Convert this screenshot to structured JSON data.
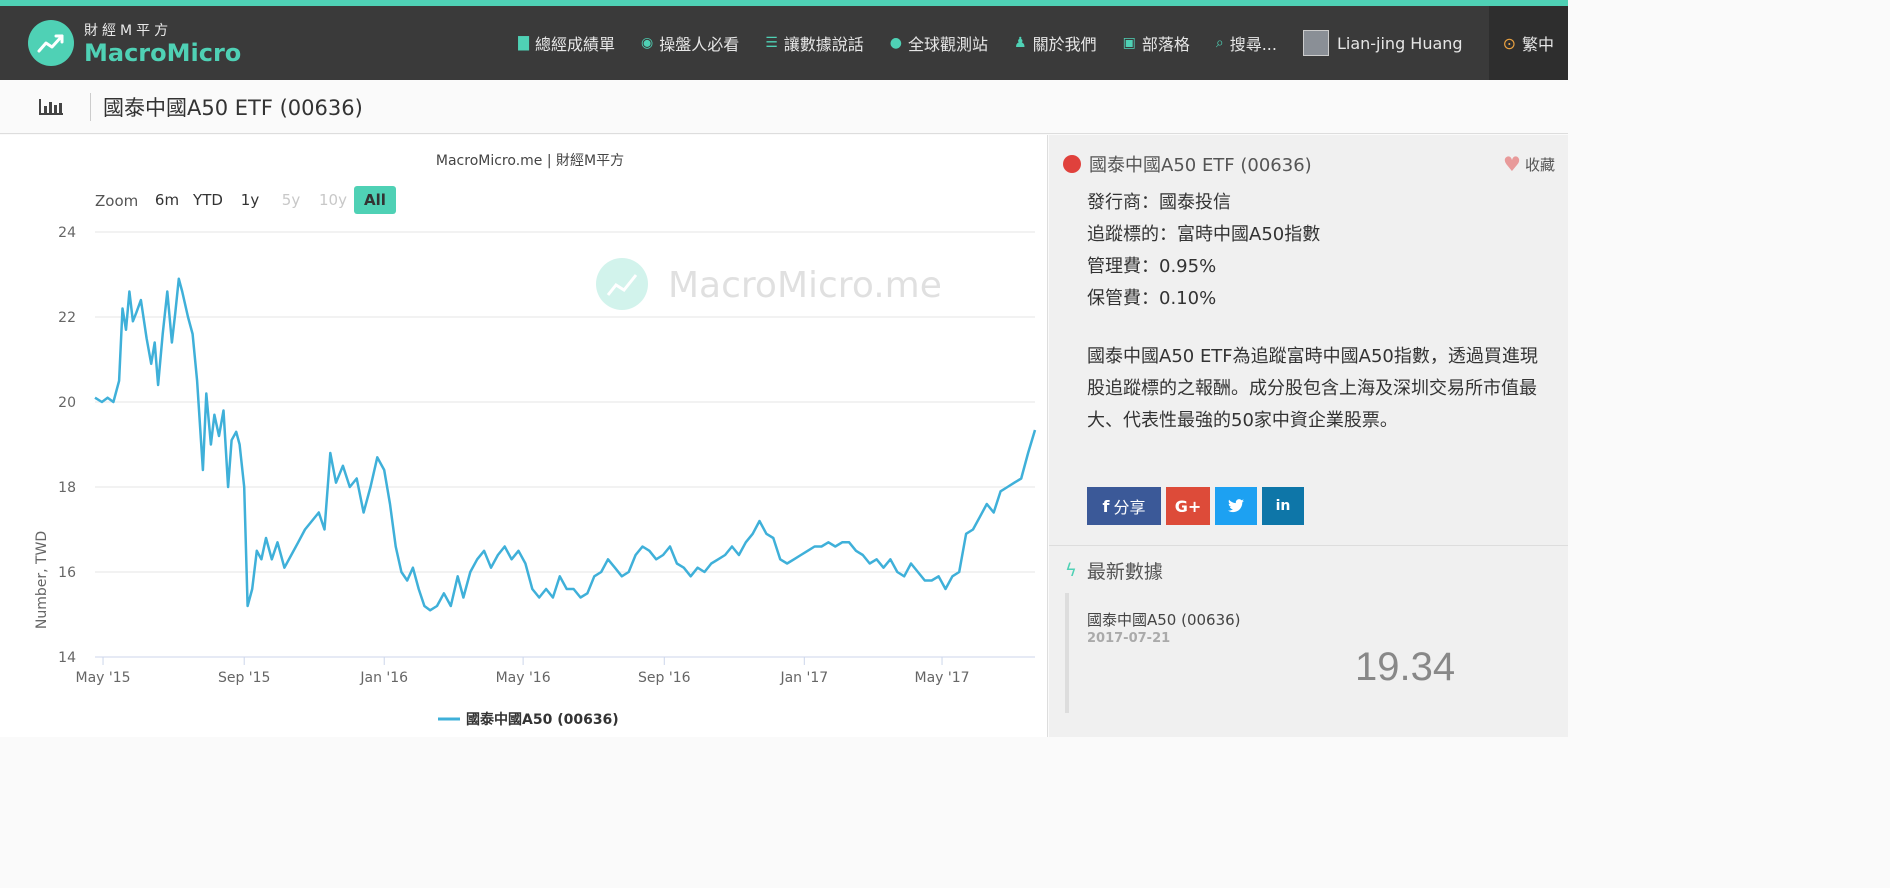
{
  "app": {
    "logo_cn": "財經M平方",
    "logo_en": "MacroMicro",
    "accent": "#4fd1b5"
  },
  "nav": {
    "items": [
      {
        "icon": "document-icon",
        "label": "總經成績單"
      },
      {
        "icon": "eye-icon",
        "label": "操盤人必看"
      },
      {
        "icon": "database-icon",
        "label": "讓數據說話"
      },
      {
        "icon": "globe-icon",
        "label": "全球觀測站"
      },
      {
        "icon": "people-icon",
        "label": "關於我們"
      },
      {
        "icon": "rss-icon",
        "label": "部落格"
      },
      {
        "icon": "search-icon",
        "label": "搜尋..."
      }
    ],
    "user_name": "Lian-jing Huang",
    "lang_label": "繁中"
  },
  "page": {
    "title": "國泰中國A50 ETF (00636)"
  },
  "chart": {
    "credit": "MacroMicro.me | 財經M平方",
    "watermark": "MacroMicro.me",
    "zoom_label": "Zoom",
    "zoom_options": [
      "6m",
      "YTD",
      "1y",
      "5y",
      "10y",
      "All"
    ],
    "zoom_active": "All",
    "zoom_disabled": [
      "5y",
      "10y"
    ]
  },
  "chart_data": {
    "type": "line",
    "ylabel": "Number, TWD",
    "ylim": [
      14,
      24
    ],
    "yticks": [
      14,
      16,
      18,
      20,
      22,
      24
    ],
    "xlim": [
      "2015-04-24",
      "2017-07-21"
    ],
    "xticks": [
      {
        "date": "2015-05-01",
        "label": "May '15"
      },
      {
        "date": "2015-09-01",
        "label": "Sep '15"
      },
      {
        "date": "2016-01-01",
        "label": "Jan '16"
      },
      {
        "date": "2016-05-01",
        "label": "May '16"
      },
      {
        "date": "2016-09-01",
        "label": "Sep '16"
      },
      {
        "date": "2017-01-01",
        "label": "Jan '17"
      },
      {
        "date": "2017-05-01",
        "label": "May '17"
      }
    ],
    "legend": "bottom",
    "series": [
      {
        "name": "國泰中國A50 (00636)",
        "color": "#3fb0d9",
        "points": [
          [
            "2015-04-24",
            20.1
          ],
          [
            "2015-04-30",
            20.0
          ],
          [
            "2015-05-05",
            20.1
          ],
          [
            "2015-05-10",
            20.0
          ],
          [
            "2015-05-15",
            20.5
          ],
          [
            "2015-05-18",
            22.2
          ],
          [
            "2015-05-21",
            21.7
          ],
          [
            "2015-05-24",
            22.6
          ],
          [
            "2015-05-27",
            21.9
          ],
          [
            "2015-05-30",
            22.1
          ],
          [
            "2015-06-03",
            22.4
          ],
          [
            "2015-06-08",
            21.5
          ],
          [
            "2015-06-12",
            20.9
          ],
          [
            "2015-06-15",
            21.4
          ],
          [
            "2015-06-18",
            20.4
          ],
          [
            "2015-06-22",
            21.6
          ],
          [
            "2015-06-26",
            22.6
          ],
          [
            "2015-06-30",
            21.4
          ],
          [
            "2015-07-03",
            22.1
          ],
          [
            "2015-07-06",
            22.9
          ],
          [
            "2015-07-09",
            22.6
          ],
          [
            "2015-07-14",
            22.0
          ],
          [
            "2015-07-18",
            21.6
          ],
          [
            "2015-07-22",
            20.5
          ],
          [
            "2015-07-27",
            18.4
          ],
          [
            "2015-07-30",
            20.2
          ],
          [
            "2015-08-03",
            19.0
          ],
          [
            "2015-08-06",
            19.7
          ],
          [
            "2015-08-10",
            19.2
          ],
          [
            "2015-08-14",
            19.8
          ],
          [
            "2015-08-18",
            18.0
          ],
          [
            "2015-08-21",
            19.1
          ],
          [
            "2015-08-25",
            19.3
          ],
          [
            "2015-08-28",
            19.0
          ],
          [
            "2015-09-01",
            18.0
          ],
          [
            "2015-09-04",
            15.2
          ],
          [
            "2015-09-08",
            15.6
          ],
          [
            "2015-09-12",
            16.5
          ],
          [
            "2015-09-16",
            16.3
          ],
          [
            "2015-09-20",
            16.8
          ],
          [
            "2015-09-25",
            16.3
          ],
          [
            "2015-09-30",
            16.7
          ],
          [
            "2015-10-06",
            16.1
          ],
          [
            "2015-10-12",
            16.4
          ],
          [
            "2015-10-18",
            16.7
          ],
          [
            "2015-10-24",
            17.0
          ],
          [
            "2015-10-30",
            17.2
          ],
          [
            "2015-11-05",
            17.4
          ],
          [
            "2015-11-10",
            17.0
          ],
          [
            "2015-11-15",
            18.8
          ],
          [
            "2015-11-20",
            18.1
          ],
          [
            "2015-11-26",
            18.5
          ],
          [
            "2015-12-02",
            18.0
          ],
          [
            "2015-12-08",
            18.2
          ],
          [
            "2015-12-14",
            17.4
          ],
          [
            "2015-12-20",
            18.0
          ],
          [
            "2015-12-26",
            18.7
          ],
          [
            "2016-01-01",
            18.4
          ],
          [
            "2016-01-06",
            17.6
          ],
          [
            "2016-01-11",
            16.6
          ],
          [
            "2016-01-16",
            16.0
          ],
          [
            "2016-01-21",
            15.8
          ],
          [
            "2016-01-26",
            16.1
          ],
          [
            "2016-01-31",
            15.6
          ],
          [
            "2016-02-05",
            15.2
          ],
          [
            "2016-02-10",
            15.1
          ],
          [
            "2016-02-16",
            15.2
          ],
          [
            "2016-02-22",
            15.5
          ],
          [
            "2016-02-28",
            15.2
          ],
          [
            "2016-03-05",
            15.9
          ],
          [
            "2016-03-10",
            15.4
          ],
          [
            "2016-03-16",
            16.0
          ],
          [
            "2016-03-22",
            16.3
          ],
          [
            "2016-03-28",
            16.5
          ],
          [
            "2016-04-03",
            16.1
          ],
          [
            "2016-04-09",
            16.4
          ],
          [
            "2016-04-15",
            16.6
          ],
          [
            "2016-04-21",
            16.3
          ],
          [
            "2016-04-27",
            16.5
          ],
          [
            "2016-05-03",
            16.2
          ],
          [
            "2016-05-09",
            15.6
          ],
          [
            "2016-05-15",
            15.4
          ],
          [
            "2016-05-21",
            15.6
          ],
          [
            "2016-05-27",
            15.4
          ],
          [
            "2016-06-02",
            15.9
          ],
          [
            "2016-06-08",
            15.6
          ],
          [
            "2016-06-14",
            15.6
          ],
          [
            "2016-06-20",
            15.4
          ],
          [
            "2016-06-26",
            15.5
          ],
          [
            "2016-07-02",
            15.9
          ],
          [
            "2016-07-08",
            16.0
          ],
          [
            "2016-07-14",
            16.3
          ],
          [
            "2016-07-20",
            16.1
          ],
          [
            "2016-07-26",
            15.9
          ],
          [
            "2016-08-01",
            16.0
          ],
          [
            "2016-08-07",
            16.4
          ],
          [
            "2016-08-13",
            16.6
          ],
          [
            "2016-08-19",
            16.5
          ],
          [
            "2016-08-25",
            16.3
          ],
          [
            "2016-08-31",
            16.4
          ],
          [
            "2016-09-06",
            16.6
          ],
          [
            "2016-09-12",
            16.2
          ],
          [
            "2016-09-18",
            16.1
          ],
          [
            "2016-09-24",
            15.9
          ],
          [
            "2016-09-30",
            16.1
          ],
          [
            "2016-10-06",
            16.0
          ],
          [
            "2016-10-12",
            16.2
          ],
          [
            "2016-10-18",
            16.3
          ],
          [
            "2016-10-24",
            16.4
          ],
          [
            "2016-10-30",
            16.6
          ],
          [
            "2016-11-05",
            16.4
          ],
          [
            "2016-11-11",
            16.7
          ],
          [
            "2016-11-17",
            16.9
          ],
          [
            "2016-11-23",
            17.2
          ],
          [
            "2016-11-29",
            16.9
          ],
          [
            "2016-12-05",
            16.8
          ],
          [
            "2016-12-11",
            16.3
          ],
          [
            "2016-12-17",
            16.2
          ],
          [
            "2016-12-23",
            16.3
          ],
          [
            "2016-12-29",
            16.4
          ],
          [
            "2017-01-04",
            16.5
          ],
          [
            "2017-01-10",
            16.6
          ],
          [
            "2017-01-16",
            16.6
          ],
          [
            "2017-01-22",
            16.7
          ],
          [
            "2017-01-28",
            16.6
          ],
          [
            "2017-02-03",
            16.7
          ],
          [
            "2017-02-09",
            16.7
          ],
          [
            "2017-02-15",
            16.5
          ],
          [
            "2017-02-21",
            16.4
          ],
          [
            "2017-02-27",
            16.2
          ],
          [
            "2017-03-05",
            16.3
          ],
          [
            "2017-03-11",
            16.1
          ],
          [
            "2017-03-17",
            16.3
          ],
          [
            "2017-03-23",
            16.0
          ],
          [
            "2017-03-29",
            15.9
          ],
          [
            "2017-04-04",
            16.2
          ],
          [
            "2017-04-10",
            16.0
          ],
          [
            "2017-04-16",
            15.8
          ],
          [
            "2017-04-22",
            15.8
          ],
          [
            "2017-04-28",
            15.9
          ],
          [
            "2017-05-04",
            15.6
          ],
          [
            "2017-05-10",
            15.9
          ],
          [
            "2017-05-16",
            16.0
          ],
          [
            "2017-05-22",
            16.9
          ],
          [
            "2017-05-28",
            17.0
          ],
          [
            "2017-06-03",
            17.3
          ],
          [
            "2017-06-09",
            17.6
          ],
          [
            "2017-06-15",
            17.4
          ],
          [
            "2017-06-21",
            17.9
          ],
          [
            "2017-06-27",
            18.0
          ],
          [
            "2017-07-03",
            18.1
          ],
          [
            "2017-07-09",
            18.2
          ],
          [
            "2017-07-15",
            18.8
          ],
          [
            "2017-07-21",
            19.34
          ]
        ]
      }
    ]
  },
  "side": {
    "title": "國泰中國A50 ETF (00636)",
    "fav_label": "收藏",
    "info_lines": [
      "發行商：國泰投信",
      "追蹤標的：富時中國A50指數",
      "管理費：0.95%",
      "保管費：0.10%"
    ],
    "description": "國泰中國A50 ETF為追蹤富時中國A50指數，透過買進現股追蹤標的之報酬。成分股包含上海及深圳交易所市值最大、代表性最強的50家中資企業股票。",
    "share": {
      "facebook_label": "分享",
      "google_label": "G+",
      "twitter_icon": "twitter-icon",
      "linkedin_label": "in"
    },
    "latest": {
      "heading": "最新數據",
      "name": "國泰中國A50 (00636)",
      "date": "2017-07-21",
      "value": "19.34"
    }
  }
}
